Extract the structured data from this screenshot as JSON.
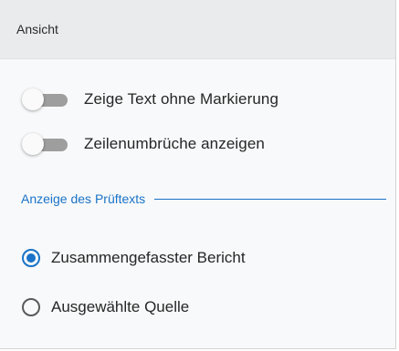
{
  "panel": {
    "title": "Ansicht"
  },
  "toggles": [
    {
      "label": "Zeige Text ohne Markierung",
      "state": "off"
    },
    {
      "label": "Zeilenumbrüche anzeigen",
      "state": "off"
    }
  ],
  "section": {
    "title": "Anzeige des Prüftexts"
  },
  "radios": [
    {
      "label": "Zusammengefasster Bericht",
      "selected": true
    },
    {
      "label": "Ausgewählte Quelle",
      "selected": false
    }
  ],
  "colors": {
    "accent": "#1a73c8",
    "track_off": "#9e9e9e",
    "header_bg": "#e9ebec",
    "panel_bg": "#f8f9fa"
  }
}
